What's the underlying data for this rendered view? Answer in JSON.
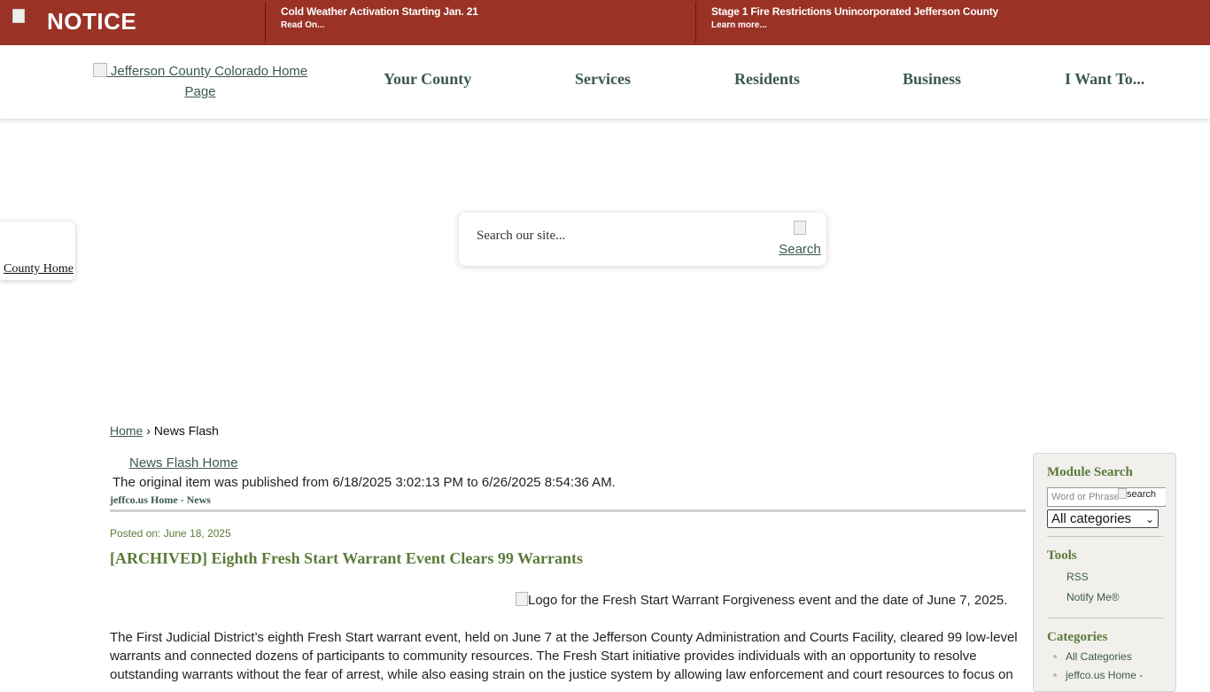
{
  "notice": {
    "title": "NOTICE",
    "icon": "notice-image-broken",
    "alerts": [
      {
        "title": "Cold Weather Activation Starting Jan. 21",
        "link": "Read On..."
      },
      {
        "title": "Stage 1 Fire Restrictions Unincorporated Jefferson County",
        "link": "Learn more..."
      }
    ]
  },
  "header": {
    "logo_alt": "Jefferson County Colorado Home Page",
    "nav": [
      "Your County",
      "Services",
      "Residents",
      "Business",
      "I Want To..."
    ]
  },
  "county_tab": {
    "label": "County Home"
  },
  "search": {
    "placeholder": "Search our site...",
    "button_alt": "Search"
  },
  "breadcrumb": {
    "home": "Home",
    "separator": "›",
    "current": "News Flash"
  },
  "article": {
    "news_flash_home": "News Flash Home",
    "archived_note": "The original item was published from 6/18/2025 3:02:13 PM to 6/26/2025 8:54:36 AM.",
    "source": "jeffco.us Home - News",
    "posted": "Posted on: June 18, 2025",
    "title": "[ARCHIVED] Eighth Fresh Start Warrant Event Clears 99 Warrants",
    "image_alt": "Logo for the Fresh Start Warrant Forgiveness event and the date of June 7, 2025.",
    "body": "The First Judicial District’s eighth Fresh Start warrant event, held on June 7 at the Jefferson County Administration and Courts Facility, cleared 99 low-level warrants and connected dozens of participants to community resources. The Fresh Start initiative provides individuals with an opportunity to resolve outstanding warrants without the fear of arrest, while also easing strain on the justice system by allowing law enforcement and court resources to focus on"
  },
  "sidebar": {
    "module_search": "Module Search",
    "search_placeholder": "Word or Phrase",
    "search_button_alt": "search",
    "category_selected": "All categories",
    "tools_heading": "Tools",
    "tools": [
      "RSS",
      "Notify Me®"
    ],
    "categories_heading": "Categories",
    "categories": [
      "All Categories",
      "jeffco.us Home -"
    ]
  },
  "colors": {
    "notice_bg": "#9a3226",
    "accent_green": "#5b7a3a",
    "link": "#3b5a4a"
  }
}
